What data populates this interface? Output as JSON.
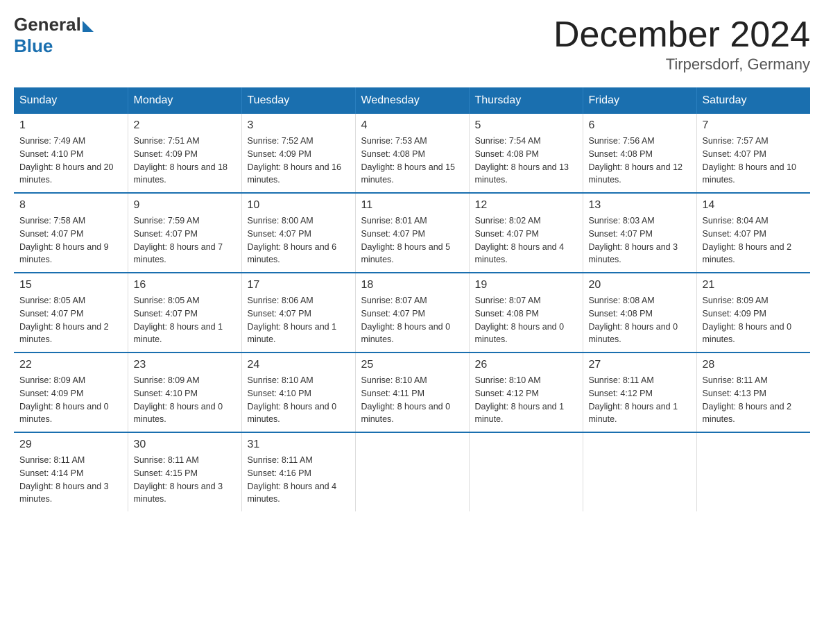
{
  "header": {
    "logo_general": "General",
    "logo_blue": "Blue",
    "month_title": "December 2024",
    "location": "Tirpersdorf, Germany"
  },
  "weekdays": [
    "Sunday",
    "Monday",
    "Tuesday",
    "Wednesday",
    "Thursday",
    "Friday",
    "Saturday"
  ],
  "weeks": [
    [
      {
        "day": "1",
        "sunrise": "7:49 AM",
        "sunset": "4:10 PM",
        "daylight": "8 hours and 20 minutes."
      },
      {
        "day": "2",
        "sunrise": "7:51 AM",
        "sunset": "4:09 PM",
        "daylight": "8 hours and 18 minutes."
      },
      {
        "day": "3",
        "sunrise": "7:52 AM",
        "sunset": "4:09 PM",
        "daylight": "8 hours and 16 minutes."
      },
      {
        "day": "4",
        "sunrise": "7:53 AM",
        "sunset": "4:08 PM",
        "daylight": "8 hours and 15 minutes."
      },
      {
        "day": "5",
        "sunrise": "7:54 AM",
        "sunset": "4:08 PM",
        "daylight": "8 hours and 13 minutes."
      },
      {
        "day": "6",
        "sunrise": "7:56 AM",
        "sunset": "4:08 PM",
        "daylight": "8 hours and 12 minutes."
      },
      {
        "day": "7",
        "sunrise": "7:57 AM",
        "sunset": "4:07 PM",
        "daylight": "8 hours and 10 minutes."
      }
    ],
    [
      {
        "day": "8",
        "sunrise": "7:58 AM",
        "sunset": "4:07 PM",
        "daylight": "8 hours and 9 minutes."
      },
      {
        "day": "9",
        "sunrise": "7:59 AM",
        "sunset": "4:07 PM",
        "daylight": "8 hours and 7 minutes."
      },
      {
        "day": "10",
        "sunrise": "8:00 AM",
        "sunset": "4:07 PM",
        "daylight": "8 hours and 6 minutes."
      },
      {
        "day": "11",
        "sunrise": "8:01 AM",
        "sunset": "4:07 PM",
        "daylight": "8 hours and 5 minutes."
      },
      {
        "day": "12",
        "sunrise": "8:02 AM",
        "sunset": "4:07 PM",
        "daylight": "8 hours and 4 minutes."
      },
      {
        "day": "13",
        "sunrise": "8:03 AM",
        "sunset": "4:07 PM",
        "daylight": "8 hours and 3 minutes."
      },
      {
        "day": "14",
        "sunrise": "8:04 AM",
        "sunset": "4:07 PM",
        "daylight": "8 hours and 2 minutes."
      }
    ],
    [
      {
        "day": "15",
        "sunrise": "8:05 AM",
        "sunset": "4:07 PM",
        "daylight": "8 hours and 2 minutes."
      },
      {
        "day": "16",
        "sunrise": "8:05 AM",
        "sunset": "4:07 PM",
        "daylight": "8 hours and 1 minute."
      },
      {
        "day": "17",
        "sunrise": "8:06 AM",
        "sunset": "4:07 PM",
        "daylight": "8 hours and 1 minute."
      },
      {
        "day": "18",
        "sunrise": "8:07 AM",
        "sunset": "4:07 PM",
        "daylight": "8 hours and 0 minutes."
      },
      {
        "day": "19",
        "sunrise": "8:07 AM",
        "sunset": "4:08 PM",
        "daylight": "8 hours and 0 minutes."
      },
      {
        "day": "20",
        "sunrise": "8:08 AM",
        "sunset": "4:08 PM",
        "daylight": "8 hours and 0 minutes."
      },
      {
        "day": "21",
        "sunrise": "8:09 AM",
        "sunset": "4:09 PM",
        "daylight": "8 hours and 0 minutes."
      }
    ],
    [
      {
        "day": "22",
        "sunrise": "8:09 AM",
        "sunset": "4:09 PM",
        "daylight": "8 hours and 0 minutes."
      },
      {
        "day": "23",
        "sunrise": "8:09 AM",
        "sunset": "4:10 PM",
        "daylight": "8 hours and 0 minutes."
      },
      {
        "day": "24",
        "sunrise": "8:10 AM",
        "sunset": "4:10 PM",
        "daylight": "8 hours and 0 minutes."
      },
      {
        "day": "25",
        "sunrise": "8:10 AM",
        "sunset": "4:11 PM",
        "daylight": "8 hours and 0 minutes."
      },
      {
        "day": "26",
        "sunrise": "8:10 AM",
        "sunset": "4:12 PM",
        "daylight": "8 hours and 1 minute."
      },
      {
        "day": "27",
        "sunrise": "8:11 AM",
        "sunset": "4:12 PM",
        "daylight": "8 hours and 1 minute."
      },
      {
        "day": "28",
        "sunrise": "8:11 AM",
        "sunset": "4:13 PM",
        "daylight": "8 hours and 2 minutes."
      }
    ],
    [
      {
        "day": "29",
        "sunrise": "8:11 AM",
        "sunset": "4:14 PM",
        "daylight": "8 hours and 3 minutes."
      },
      {
        "day": "30",
        "sunrise": "8:11 AM",
        "sunset": "4:15 PM",
        "daylight": "8 hours and 3 minutes."
      },
      {
        "day": "31",
        "sunrise": "8:11 AM",
        "sunset": "4:16 PM",
        "daylight": "8 hours and 4 minutes."
      },
      null,
      null,
      null,
      null
    ]
  ]
}
